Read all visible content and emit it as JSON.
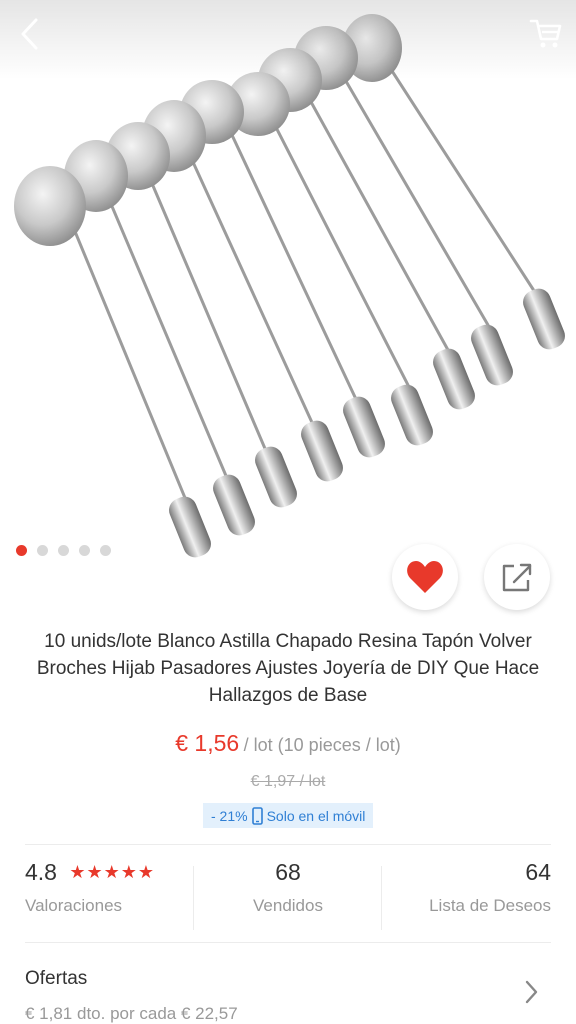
{
  "product": {
    "title": "10 unids/lote Blanco Astilla Chapado Resina Tapón Volver Broches Hijab Pasadores Ajustes Joyería de DIY Que Hace Hallazgos de Base",
    "image_alt": "stick pins with flat round pad, silver",
    "gallery": {
      "total_images": 5,
      "active_index": 0
    }
  },
  "price": {
    "current": "€ 1,56",
    "unit": "/ lot (10 pieces / lot)",
    "original": "€ 1,97  / lot"
  },
  "discount": {
    "percent": "- 21%",
    "mobile_only": "Solo en el móvil"
  },
  "stats": {
    "rating": {
      "value": "4.8",
      "stars": "★★★★★",
      "label": "Valoraciones"
    },
    "sold": {
      "value": "68",
      "label": "Vendidos"
    },
    "wishlist": {
      "value": "64",
      "label": "Lista de Deseos"
    }
  },
  "offers": {
    "title": "Ofertas",
    "subtitle": "€ 1,81 dto. por cada € 22,57"
  },
  "icons": {
    "back": "chevron-left-icon",
    "cart": "cart-icon",
    "favorite": "heart-icon",
    "share": "share-icon",
    "offers_arrow": "chevron-right-icon",
    "mobile": "phone-icon"
  },
  "colors": {
    "accent": "#e8392b",
    "badge_bg": "#e3f0fc",
    "badge_text": "#2f7fd4",
    "muted_text": "#999999"
  }
}
